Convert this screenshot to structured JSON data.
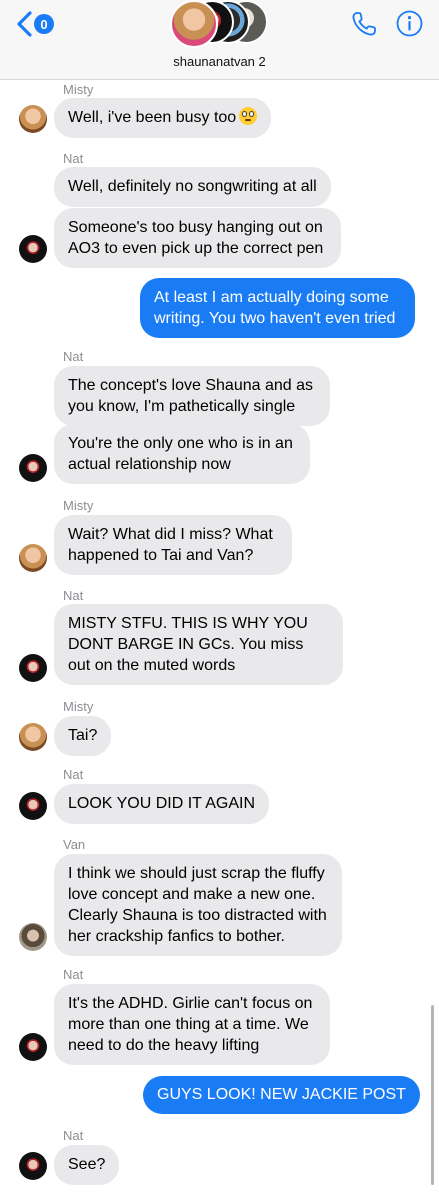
{
  "header": {
    "back_badge": "0",
    "group_name": "shaunanatvan 2",
    "icons": {
      "back": "chevron-left-icon",
      "call": "phone-icon",
      "info": "info-icon"
    },
    "accent_color": "#1a7cf5"
  },
  "thread": [
    {
      "type": "sender",
      "text": "Misty"
    },
    {
      "type": "in",
      "text": "Well, i've been busy too",
      "emoji": "flushed-face"
    },
    {
      "type": "sender",
      "text": "Nat"
    },
    {
      "type": "in",
      "text": "Well, definitely no songwriting at all"
    },
    {
      "type": "in",
      "text": "Someone's too busy hanging out on AO3 to even pick up the correct pen"
    },
    {
      "type": "out",
      "text": "At least I am actually doing some writing. You two haven't even tried"
    },
    {
      "type": "sender",
      "text": "Nat"
    },
    {
      "type": "in",
      "text": "The concept's love Shauna and as you know, I'm pathetically single"
    },
    {
      "type": "in",
      "text": "You're the only one who is in an actual relationship now"
    },
    {
      "type": "sender",
      "text": "Misty"
    },
    {
      "type": "in",
      "text": "Wait? What did I miss? What happened to Tai and Van?"
    },
    {
      "type": "sender",
      "text": "Nat"
    },
    {
      "type": "in",
      "text": "MISTY STFU. THIS IS WHY YOU DONT BARGE IN GCs. You miss out on the muted words"
    },
    {
      "type": "sender",
      "text": "Misty"
    },
    {
      "type": "in",
      "text": "Tai?"
    },
    {
      "type": "sender",
      "text": "Nat"
    },
    {
      "type": "in",
      "text": "LOOK YOU DID IT AGAIN"
    },
    {
      "type": "sender",
      "text": "Van"
    },
    {
      "type": "in",
      "text": "I think we should just scrap the fluffy love concept and make a new one. Clearly Shauna is too distracted with her crackship fanfics to bother."
    },
    {
      "type": "sender",
      "text": "Nat"
    },
    {
      "type": "in",
      "text": "It's the ADHD. Girlie can't focus on more than one thing at a time. We need  to do the heavy lifting"
    },
    {
      "type": "out",
      "text": "GUYS LOOK! NEW JACKIE POST"
    },
    {
      "type": "sender",
      "text": "Nat"
    },
    {
      "type": "in",
      "text": "See?"
    }
  ]
}
